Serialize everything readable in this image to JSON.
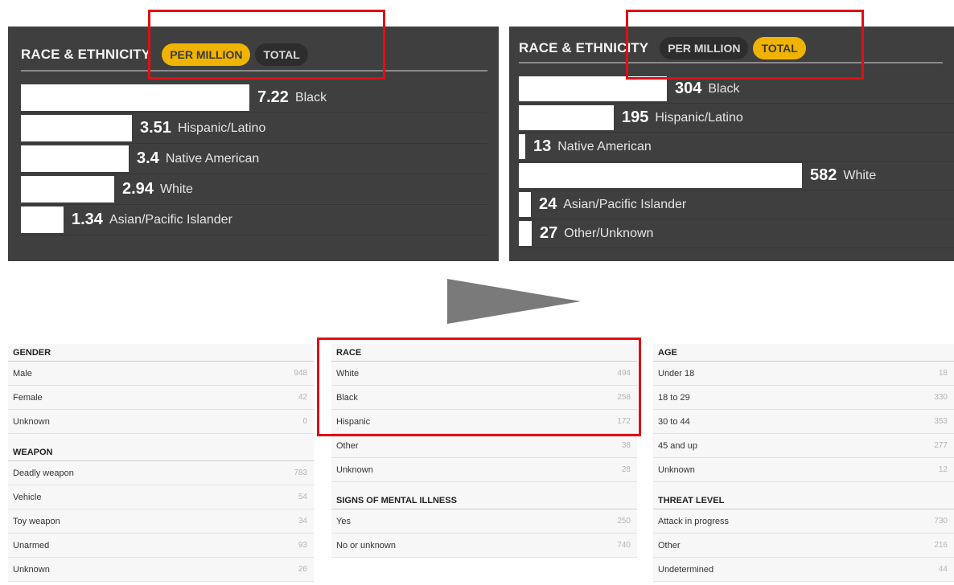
{
  "per_million_panel": {
    "title": "RACE & ETHNICITY",
    "toggle_per_million": "PER MILLION",
    "toggle_total": "TOTAL",
    "active_toggle": "per_million",
    "max_value": 7.22,
    "rows": [
      {
        "value": "7.22",
        "num": 7.22,
        "label": "Black"
      },
      {
        "value": "3.51",
        "num": 3.51,
        "label": "Hispanic/Latino"
      },
      {
        "value": "3.4",
        "num": 3.4,
        "label": "Native American"
      },
      {
        "value": "2.94",
        "num": 2.94,
        "label": "White"
      },
      {
        "value": "1.34",
        "num": 1.34,
        "label": "Asian/Pacific Islander"
      }
    ]
  },
  "total_panel": {
    "title": "RACE & ETHNICITY",
    "toggle_per_million": "PER MILLION",
    "toggle_total": "TOTAL",
    "active_toggle": "total",
    "max_value": 582,
    "rows": [
      {
        "value": "304",
        "num": 304,
        "label": "Black"
      },
      {
        "value": "195",
        "num": 195,
        "label": "Hispanic/Latino"
      },
      {
        "value": "13",
        "num": 13,
        "label": "Native American"
      },
      {
        "value": "582",
        "num": 582,
        "label": "White"
      },
      {
        "value": "24",
        "num": 24,
        "label": "Asian/Pacific Islander"
      },
      {
        "value": "27",
        "num": 27,
        "label": "Other/Unknown"
      }
    ]
  },
  "colors": {
    "panel_bg": "#3f3f3f",
    "toggle_active": "#f0b400",
    "highlight": "#e20e14",
    "arrow": "#7a7a7a"
  },
  "tables": {
    "gender": {
      "title": "GENDER",
      "rows": [
        {
          "label": "Male",
          "value": "948"
        },
        {
          "label": "Female",
          "value": "42"
        },
        {
          "label": "Unknown",
          "value": "0"
        }
      ]
    },
    "weapon": {
      "title": "WEAPON",
      "rows": [
        {
          "label": "Deadly weapon",
          "value": "783"
        },
        {
          "label": "Vehicle",
          "value": "54"
        },
        {
          "label": "Toy weapon",
          "value": "34"
        },
        {
          "label": "Unarmed",
          "value": "93"
        },
        {
          "label": "Unknown",
          "value": "26"
        }
      ]
    },
    "race": {
      "title": "RACE",
      "rows": [
        {
          "label": "White",
          "value": "494"
        },
        {
          "label": "Black",
          "value": "258"
        },
        {
          "label": "Hispanic",
          "value": "172"
        },
        {
          "label": "Other",
          "value": "38"
        },
        {
          "label": "Unknown",
          "value": "28"
        }
      ]
    },
    "mental": {
      "title": "SIGNS OF MENTAL ILLNESS",
      "rows": [
        {
          "label": "Yes",
          "value": "250"
        },
        {
          "label": "No or unknown",
          "value": "740"
        }
      ]
    },
    "age": {
      "title": "AGE",
      "rows": [
        {
          "label": "Under 18",
          "value": "18"
        },
        {
          "label": "18 to 29",
          "value": "330"
        },
        {
          "label": "30 to 44",
          "value": "353"
        },
        {
          "label": "45 and up",
          "value": "277"
        },
        {
          "label": "Unknown",
          "value": "12"
        }
      ]
    },
    "threat": {
      "title": "THREAT LEVEL",
      "rows": [
        {
          "label": "Attack in progress",
          "value": "730"
        },
        {
          "label": "Other",
          "value": "216"
        },
        {
          "label": "Undetermined",
          "value": "44"
        }
      ]
    }
  }
}
